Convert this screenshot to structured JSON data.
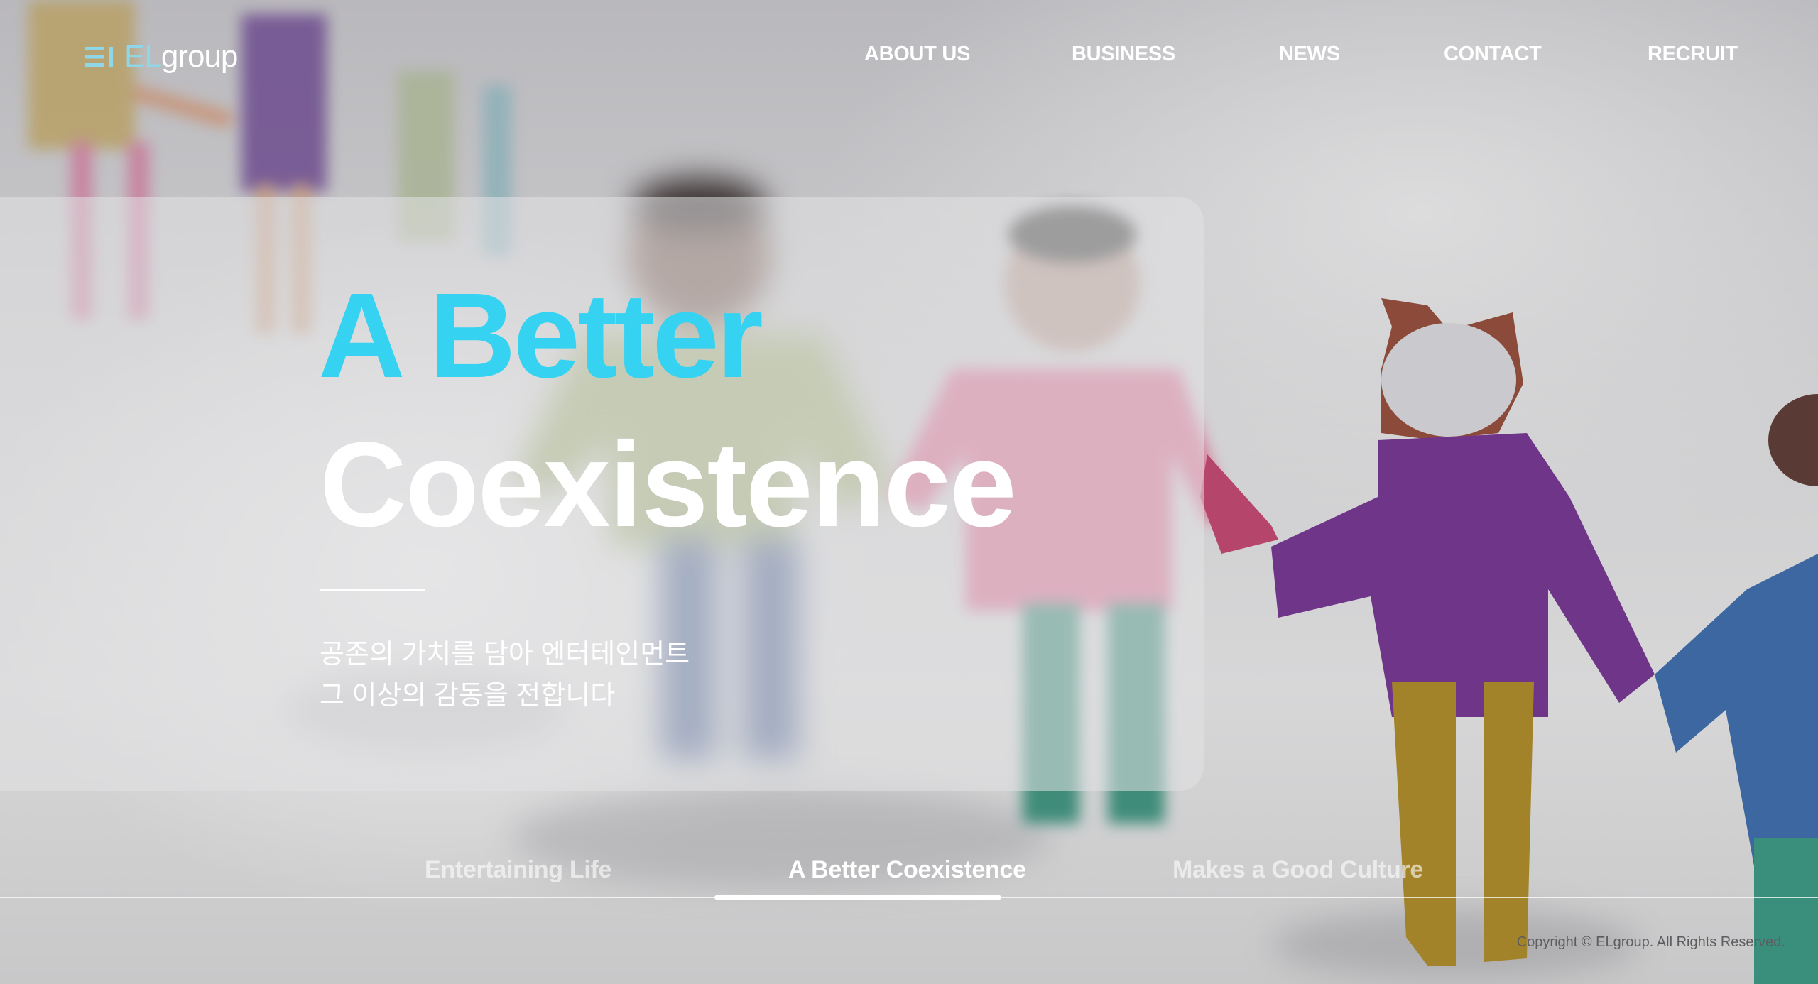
{
  "header": {
    "logo": {
      "prefix": "EL",
      "suffix": "group",
      "icon": "menu-icon"
    },
    "nav": [
      {
        "label": "ABOUT US"
      },
      {
        "label": "BUSINESS"
      },
      {
        "label": "NEWS"
      },
      {
        "label": "CONTACT"
      },
      {
        "label": "RECRUIT"
      }
    ]
  },
  "hero": {
    "line1": "A Better",
    "line2": "Coexistence",
    "sub_line1": "공존의 가치를 담아 엔터테인먼트",
    "sub_line2": "그 이상의 감동을 전합니다"
  },
  "tabs": [
    {
      "label": "Entertaining Life",
      "active": false
    },
    {
      "label": "A Better Coexistence",
      "active": true
    },
    {
      "label": "Makes a Good Culture",
      "active": false
    }
  ],
  "footer": {
    "copyright": "Copyright © ELgroup. All Rights Reserved."
  },
  "colors": {
    "accent": "#35d3f1",
    "logo_el": "#8fd7e6",
    "text": "#ffffff"
  }
}
